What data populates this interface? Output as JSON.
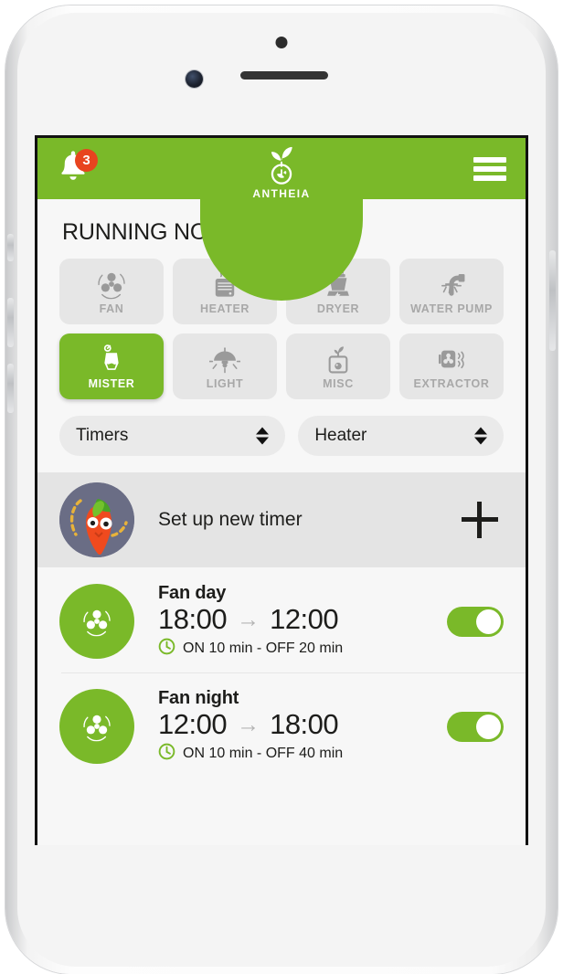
{
  "app": {
    "brand_name": "ANTHEIA",
    "accent_green": "#7ab929",
    "badge_red": "#e8441f"
  },
  "header": {
    "notifications_count": "3",
    "bell_icon": "bell-icon",
    "menu_icon": "hamburger-menu-icon",
    "logo_icon": "sprout-logo-icon"
  },
  "main": {
    "running_now_title": "RUNNING NOW:",
    "devices": [
      {
        "label": "FAN",
        "icon": "fan-icon",
        "active": false
      },
      {
        "label": "HEATER",
        "icon": "heater-icon",
        "active": false
      },
      {
        "label": "DRYER",
        "icon": "dryer-icon",
        "active": false
      },
      {
        "label": "WATER PUMP",
        "icon": "water-pump-icon",
        "active": false
      },
      {
        "label": "MISTER",
        "icon": "mister-icon",
        "active": true
      },
      {
        "label": "LIGHT",
        "icon": "light-icon",
        "active": false
      },
      {
        "label": "MISC",
        "icon": "misc-plant-icon",
        "active": false
      },
      {
        "label": "EXTRACTOR",
        "icon": "extractor-icon",
        "active": false
      }
    ]
  },
  "selects": {
    "mode": {
      "value": "Timers",
      "icon": "stepper-arrows-icon"
    },
    "device": {
      "value": "Heater",
      "icon": "stepper-arrows-icon"
    }
  },
  "new_timer": {
    "label": "Set up new timer",
    "avatar_icon": "carrot-mascot-avatar",
    "add_icon": "plus-icon"
  },
  "timers": [
    {
      "name": "Fan day",
      "start_time": "18:00",
      "arrow": "→",
      "end_time": "12:00",
      "schedule": "ON 10 min - OFF 20 min",
      "clock_icon": "clock-icon",
      "device_icon": "fan-icon",
      "enabled": true
    },
    {
      "name": "Fan night",
      "start_time": "12:00",
      "arrow": "→",
      "end_time": "18:00",
      "schedule": "ON 10 min - OFF 40 min",
      "clock_icon": "clock-icon",
      "device_icon": "fan-icon",
      "enabled": true
    }
  ]
}
